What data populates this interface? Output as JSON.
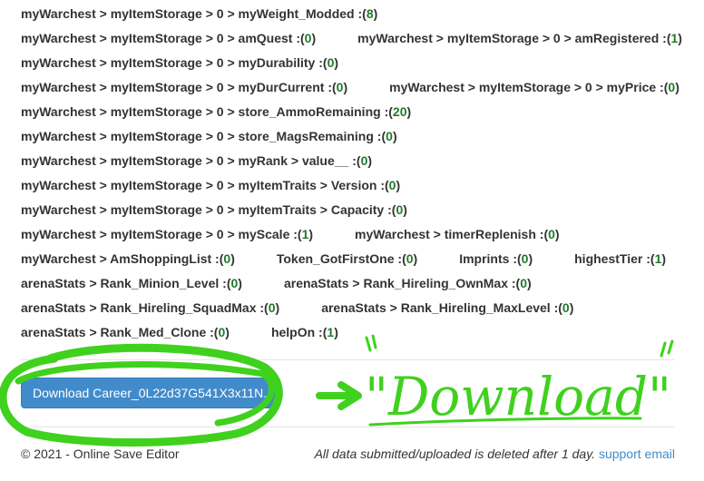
{
  "rows": [
    [
      {
        "label": "myWarchest > myItemStorage > 0 > myWeight_Modded :",
        "value": "8"
      }
    ],
    [
      {
        "label": "myWarchest > myItemStorage > 0 > amQuest :",
        "value": "0"
      },
      {
        "label": "myWarchest > myItemStorage > 0 > amRegistered :",
        "value": "1"
      }
    ],
    [
      {
        "label": "myWarchest > myItemStorage > 0 > myDurability :",
        "value": "0"
      }
    ],
    [
      {
        "label": "myWarchest > myItemStorage > 0 > myDurCurrent :",
        "value": "0"
      },
      {
        "label": "myWarchest > myItemStorage > 0 > myPrice :",
        "value": "0"
      }
    ],
    [
      {
        "label": "myWarchest > myItemStorage > 0 > store_AmmoRemaining :",
        "value": "20"
      }
    ],
    [
      {
        "label": "myWarchest > myItemStorage > 0 > store_MagsRemaining :",
        "value": "0"
      }
    ],
    [
      {
        "label": "myWarchest > myItemStorage > 0 > myRank > value__ :",
        "value": "0"
      }
    ],
    [
      {
        "label": "myWarchest > myItemStorage > 0 > myItemTraits > Version :",
        "value": "0"
      }
    ],
    [
      {
        "label": "myWarchest > myItemStorage > 0 > myItemTraits > Capacity :",
        "value": "0"
      }
    ],
    [
      {
        "label": "myWarchest > myItemStorage > 0 > myScale :",
        "value": "1"
      },
      {
        "label": "myWarchest > timerReplenish :",
        "value": "0"
      }
    ],
    [
      {
        "label": "myWarchest > AmShoppingList :",
        "value": "0"
      },
      {
        "label": "Token_GotFirstOne :",
        "value": "0"
      },
      {
        "label": "Imprints :",
        "value": "0"
      },
      {
        "label": "highestTier :",
        "value": "1"
      }
    ],
    [
      {
        "label": "arenaStats > Rank_Minion_Level :",
        "value": "0"
      },
      {
        "label": "arenaStats > Rank_Hireling_OwnMax :",
        "value": "0"
      }
    ],
    [
      {
        "label": "arenaStats > Rank_Hireling_SquadMax :",
        "value": "0"
      },
      {
        "label": "arenaStats > Rank_Hireling_MaxLevel :",
        "value": "0"
      }
    ],
    [
      {
        "label": "arenaStats > Rank_Med_Clone :",
        "value": "0"
      },
      {
        "label": "helpOn :",
        "value": "1"
      }
    ]
  ],
  "download_button": {
    "label": "Download Career_0L22d37G541X3x11N..."
  },
  "annotation": {
    "text": "\"Download\"",
    "color": "#3fd11e"
  },
  "footer": {
    "copyright": "© 2021 - Online Save Editor",
    "notice": "All data submitted/uploaded is deleted after 1 day.",
    "support_link": "support email"
  },
  "colors": {
    "value_green": "#1f7a2a",
    "button_blue": "#428bca"
  }
}
